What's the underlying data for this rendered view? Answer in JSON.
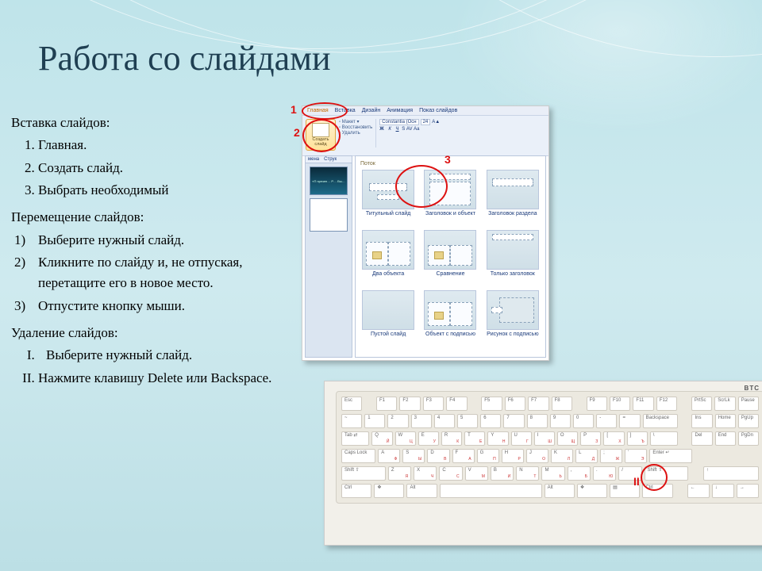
{
  "title": "Работа со слайдами",
  "insert": {
    "heading": "Вставка слайдов:",
    "items": [
      "Главная.",
      "Создать слайд.",
      "Выбрать необходимый"
    ]
  },
  "move": {
    "heading": "Перемещение слайдов:",
    "items": [
      "Выберите нужный слайд.",
      "Кликните по слайду и, не отпуская, перетащите его в новое место.",
      "Отпустите кнопку мыши."
    ]
  },
  "del": {
    "heading": "Удаление слайдов:",
    "items": [
      "Выберите нужный слайд.",
      "Нажмите клавишу Delete или Backspace."
    ]
  },
  "marks": {
    "one": "1",
    "two": "2",
    "three": "3",
    "roman2": "II"
  },
  "ppt": {
    "tabs": [
      "Главная",
      "Вставка",
      "Дизайн",
      "Анимация",
      "Показ слайдов"
    ],
    "new_slide": "Создать слайд",
    "mini": [
      "Макет ▾",
      "Восстановить",
      "Удалить"
    ],
    "group": "Поток",
    "thumb_tabs": [
      "мена",
      "Струк"
    ],
    "thumb_text": "«П презен… Р… Вы…",
    "font_name": "Constantia (Осн",
    "font_size": "24",
    "layouts": [
      "Титульный слайд",
      "Заголовок и объект",
      "Заголовок раздела",
      "Два объекта",
      "Сравнение",
      "Только заголовок",
      "Пустой слайд",
      "Объект с подписью",
      "Рисунок с подписью"
    ]
  },
  "kb": {
    "brand": "BTC",
    "frow": [
      "Esc",
      "F1",
      "F2",
      "F3",
      "F4",
      "F5",
      "F6",
      "F7",
      "F8",
      "F9",
      "F10",
      "F11",
      "F12"
    ],
    "util": [
      "PrtSc",
      "ScrLk",
      "Pause"
    ],
    "row1": [
      "~",
      "1",
      "2",
      "3",
      "4",
      "5",
      "6",
      "7",
      "8",
      "9",
      "0",
      "-",
      "="
    ],
    "back": "Backspace",
    "nav1": [
      "Ins",
      "Home",
      "PgUp"
    ],
    "row2_lead": "Tab ⇄",
    "row2": [
      "Q",
      "W",
      "E",
      "R",
      "T",
      "Y",
      "U",
      "I",
      "O",
      "P",
      "[",
      "]"
    ],
    "row2_ru": [
      "Й",
      "Ц",
      "У",
      "К",
      "Е",
      "Н",
      "Г",
      "Ш",
      "Щ",
      "З",
      "Х",
      "Ъ"
    ],
    "row2_end": "\\",
    "nav2": [
      "Del",
      "End",
      "PgDn"
    ],
    "row3_lead": "Caps Lock",
    "row3": [
      "A",
      "S",
      "D",
      "F",
      "G",
      "H",
      "J",
      "K",
      "L",
      ";",
      "'"
    ],
    "row3_ru": [
      "Ф",
      "Ы",
      "В",
      "А",
      "П",
      "Р",
      "О",
      "Л",
      "Д",
      "Ж",
      "Э"
    ],
    "enter": "Enter ↵",
    "row4_lead": "Shift ⇧",
    "row4": [
      "Z",
      "X",
      "C",
      "V",
      "B",
      "N",
      "M",
      ",",
      ".",
      "/"
    ],
    "row4_ru": [
      "Я",
      "Ч",
      "С",
      "М",
      "И",
      "Т",
      "Ь",
      "Б",
      "Ю",
      "."
    ],
    "row4_end": "Shift ⇧",
    "arrow_up": "↑",
    "row5": [
      "Ctrl",
      "❖",
      "Alt"
    ],
    "row5r": [
      "Alt",
      "❖",
      "▤",
      "Ctrl"
    ],
    "arrows": [
      "←",
      "↓",
      "→"
    ]
  }
}
